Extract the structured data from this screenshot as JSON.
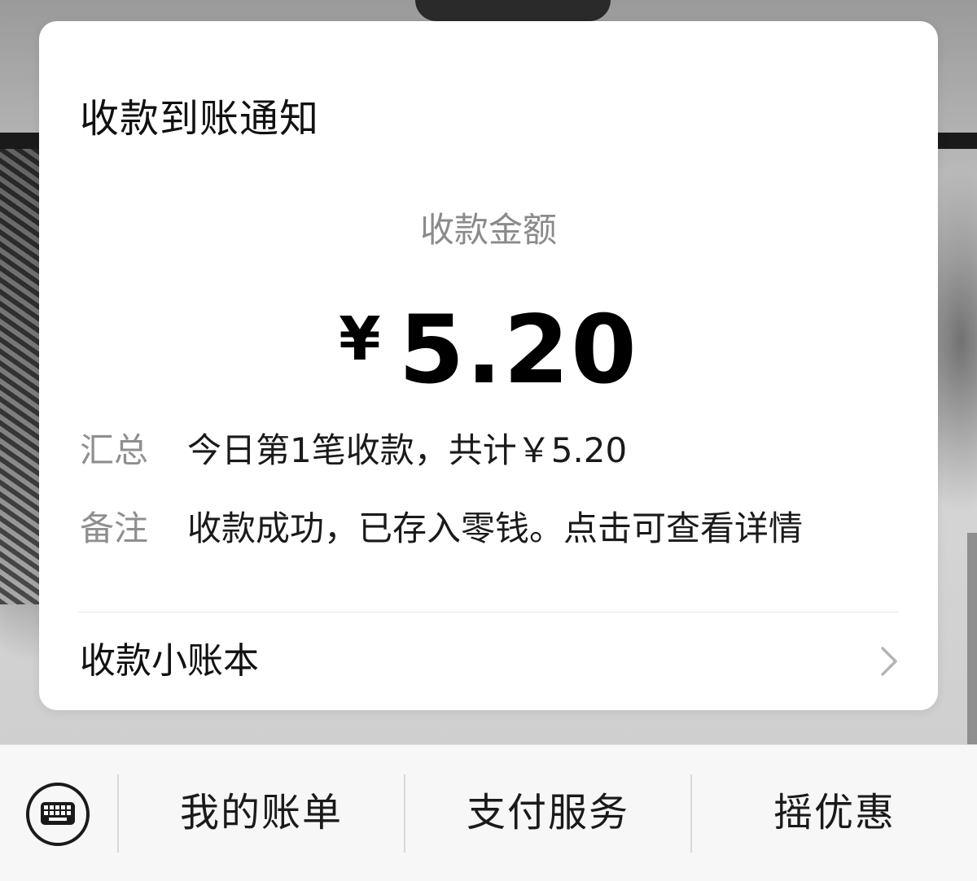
{
  "notification": {
    "title": "收款到账通知",
    "amount_label": "收款金额",
    "currency_symbol": "¥",
    "amount": "5.20",
    "summary_key": "汇总",
    "summary_value": "今日第1笔收款，共计￥5.20",
    "remark_key": "备注",
    "remark_value": "收款成功，已存入零钱。点击可查看详情",
    "ledger_link": "收款小账本",
    "ledger_icon": "chevron-right-icon"
  },
  "menu": {
    "keyboard_icon": "keyboard-icon",
    "items": [
      {
        "label": "我的账单"
      },
      {
        "label": "支付服务"
      },
      {
        "label": "摇优惠"
      }
    ]
  },
  "colors": {
    "card_bg": "#ffffff",
    "label_grey": "#8f8f8f",
    "text_dark": "#111111",
    "menu_bg": "#f7f7f7"
  }
}
